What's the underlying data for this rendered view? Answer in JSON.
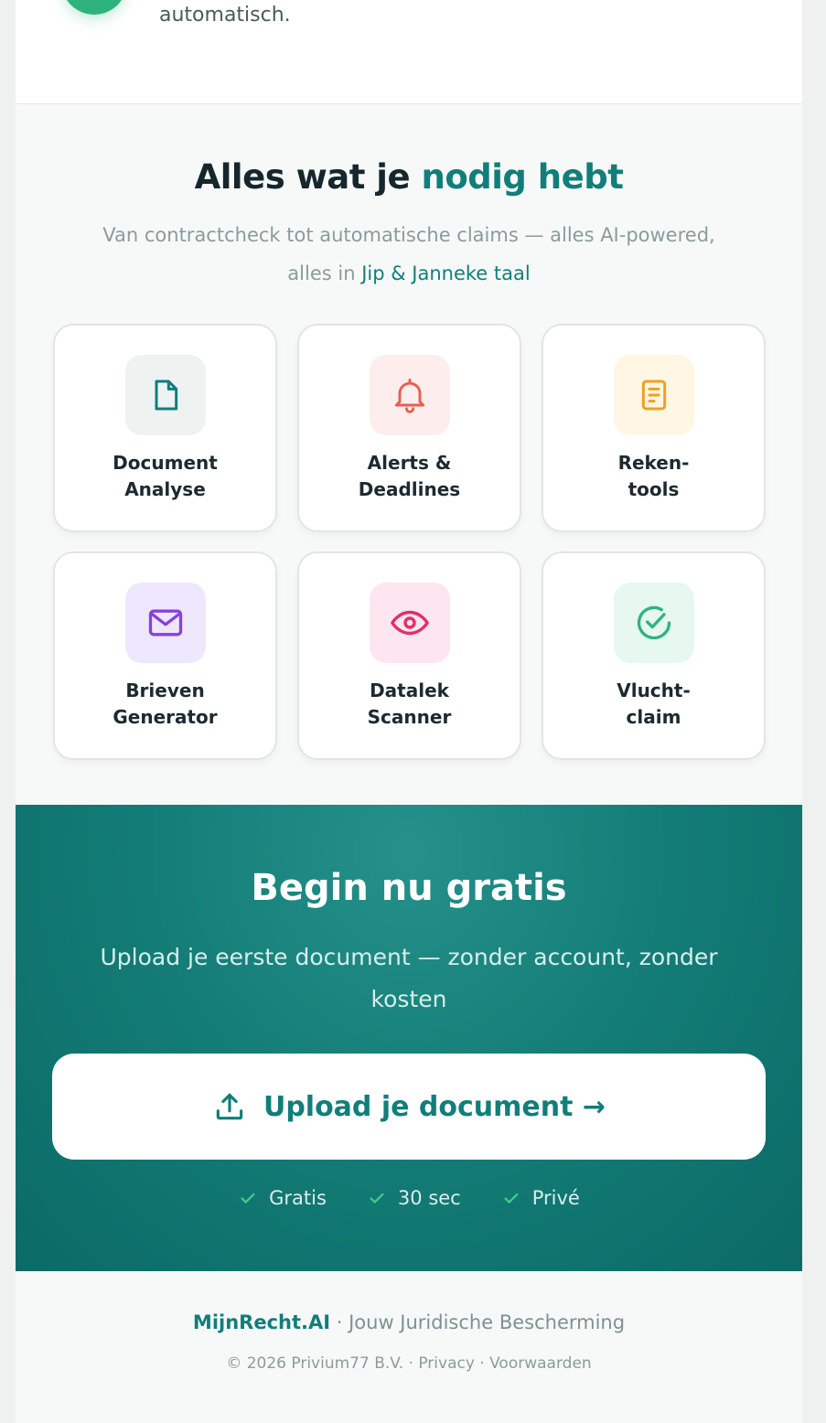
{
  "top": {
    "text": "automatisch."
  },
  "section": {
    "title_main": "Alles wat je",
    "title_accent": "nodig hebt",
    "subtitle_main": "Van contractcheck tot automatische claims — alles AI-powered, alles in",
    "subtitle_accent": "Jip & Janneke taal"
  },
  "features": [
    {
      "label": "Document\nAnalyse",
      "icon": "document-icon",
      "bg": "#eef3f2",
      "color": "#117e7a"
    },
    {
      "label": "Alerts &\nDeadlines",
      "icon": "bell-icon",
      "bg": "#fdeeed",
      "color": "#e5604f"
    },
    {
      "label": "Reken-\ntools",
      "icon": "calculator-icon",
      "bg": "#fff7e3",
      "color": "#f0a020"
    },
    {
      "label": "Brieven\nGenerator",
      "icon": "mail-icon",
      "bg": "#efe7fd",
      "color": "#8a3fe0"
    },
    {
      "label": "Datalek\nScanner",
      "icon": "eye-icon",
      "bg": "#fde6ef",
      "color": "#e0306a"
    },
    {
      "label": "Vlucht-\nclaim",
      "icon": "check-circle-icon",
      "bg": "#e6f8f0",
      "color": "#2fb37e"
    }
  ],
  "cta": {
    "title": "Begin nu gratis",
    "text": "Upload je eerste document — zonder account, zonder kosten",
    "button_label": "Upload je document →",
    "perks": [
      "Gratis",
      "30 sec",
      "Privé"
    ],
    "check_color": "#3ecf8e"
  },
  "footer": {
    "brand": "MijnRecht.AI",
    "tagline": " · Jouw Juridische Bescherming",
    "copyright": "© 2026 Privium77 B.V.",
    "sep": " · ",
    "privacy": "Privacy",
    "terms": "Voorwaarden"
  }
}
